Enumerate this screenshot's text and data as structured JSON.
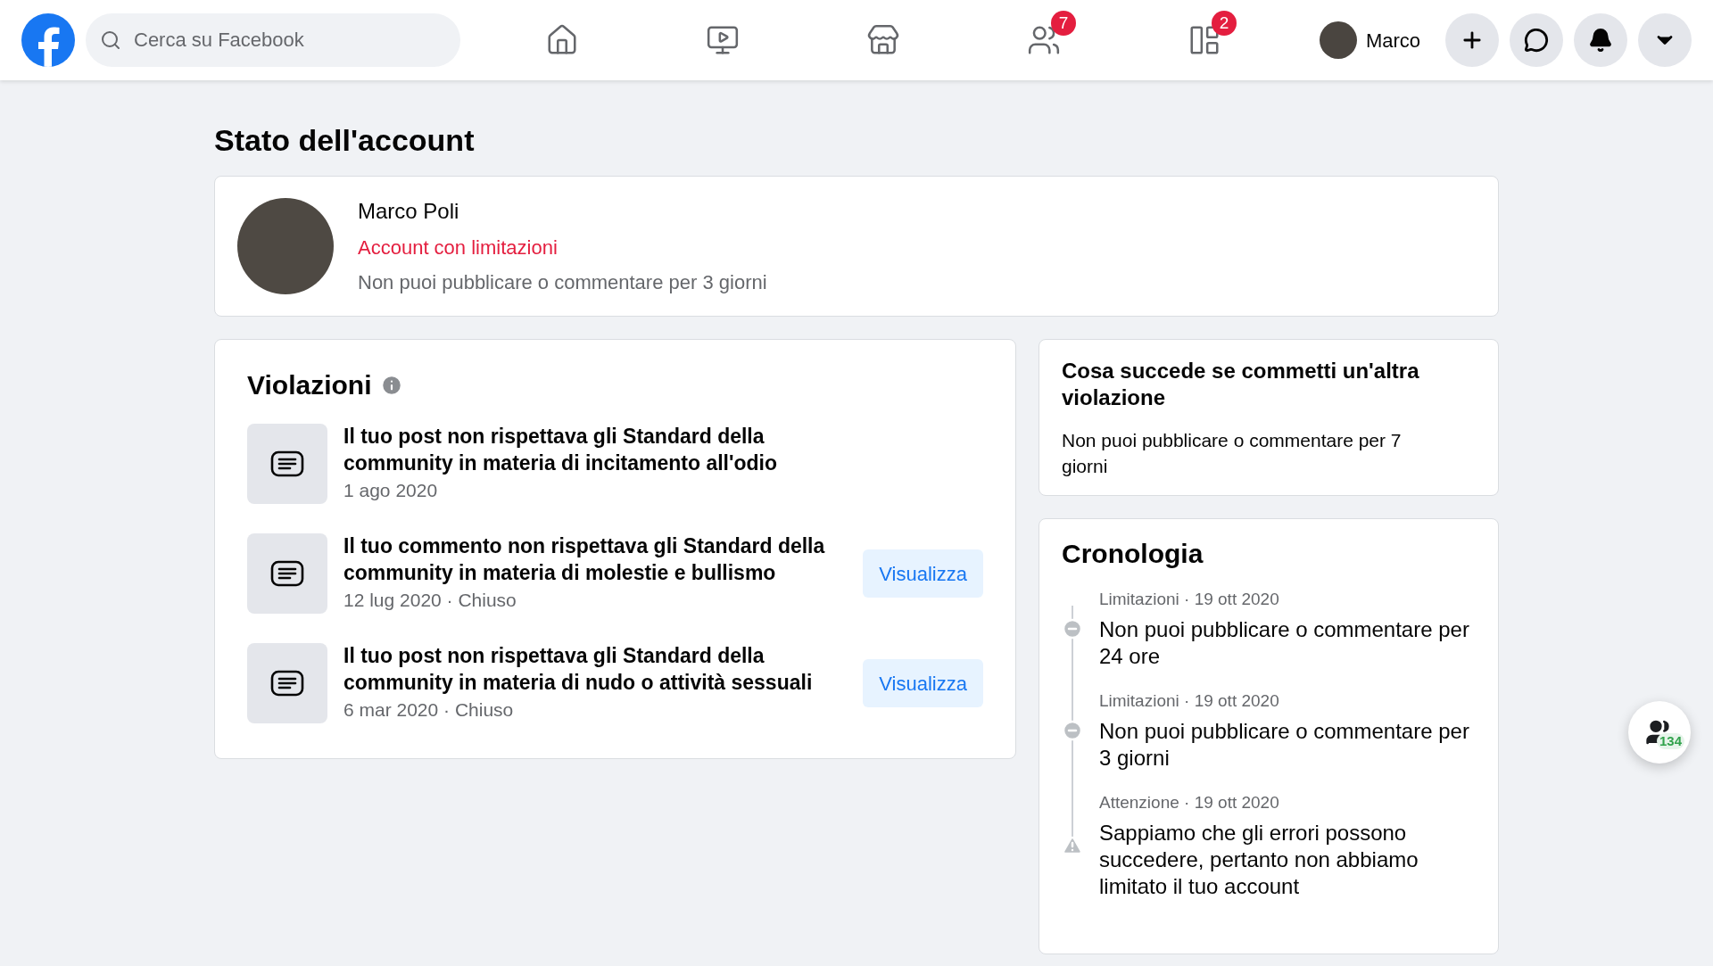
{
  "topbar": {
    "search": {
      "placeholder": "Cerca su Facebook"
    },
    "nav": [
      {
        "kind": "home"
      },
      {
        "kind": "watch"
      },
      {
        "kind": "market"
      },
      {
        "kind": "groups",
        "badge": "7"
      },
      {
        "kind": "gaming",
        "badge": "2"
      }
    ],
    "user": "Marco"
  },
  "page_title": "Stato dell'account",
  "profile": {
    "name": "Marco Poli",
    "status": "Account con limitazioni",
    "detail": "Non puoi pubblicare o commentare per 3 giorni"
  },
  "violations": {
    "title": "Violazioni",
    "items": [
      {
        "text": "Il tuo post non rispettava gli Standard della community in materia di incitamento all'odio",
        "meta": "1 ago 2020"
      },
      {
        "text": "Il tuo commento non rispettava gli Standard della community in materia di molestie e bullismo",
        "meta": "12 lug 2020 · Chiuso",
        "action": "Visualizza"
      },
      {
        "text": "Il tuo post non rispettava gli Standard della community in materia di nudo o attività sessuali",
        "meta": "6 mar 2020 · Chiuso",
        "action": "Visualizza"
      }
    ]
  },
  "next_violation": {
    "title": "Cosa succede se commetti un'altra violazione",
    "text": "Non puoi pubblicare o commentare per 7 giorni"
  },
  "timeline": {
    "title": "Cronologia",
    "items": [
      {
        "kind": "restriction",
        "meta": "Limitazioni · 19 ott 2020",
        "text": "Non puoi pubblicare o commentare per 24 ore"
      },
      {
        "kind": "restriction",
        "meta": "Limitazioni · 19 ott 2020",
        "text": "Non puoi pubblicare o commentare per 3 giorni"
      },
      {
        "kind": "warning",
        "meta": "Attenzione · 19 ott 2020",
        "text": "Sappiamo che gli errori possono succedere, pertanto non abbiamo limitato il tuo account"
      }
    ]
  },
  "contacts_badge": "134"
}
